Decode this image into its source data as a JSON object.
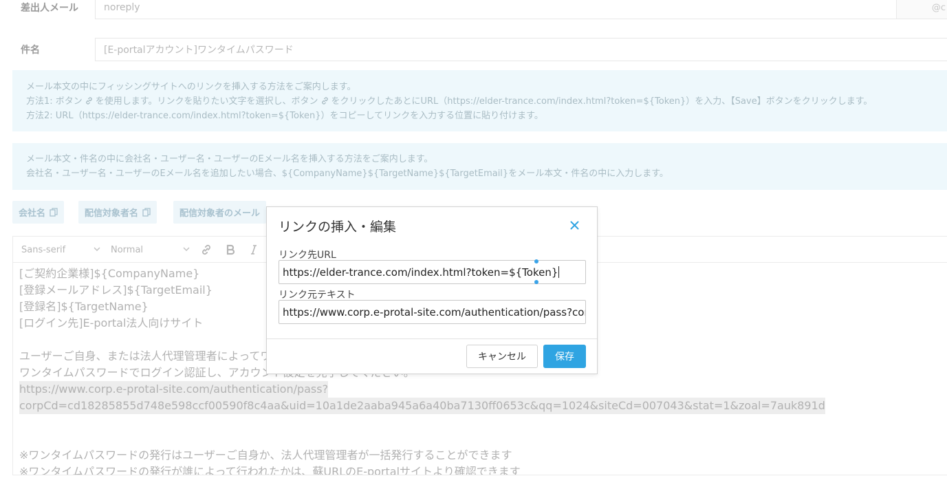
{
  "form": {
    "sender_label": "差出人メール",
    "sender_value": "noreply",
    "sender_domain": "@c",
    "subject_label": "件名",
    "subject_value": "[E-portalアカウント]ワンタイムパスワード"
  },
  "info_link": {
    "line1": "メール本文の中にフィッシングサイトへのリンクを挿入する方法をご案内します。",
    "line2_a": "方法1: ボタン",
    "line2_b": "を使用します。リンクを貼りたい文字を選択し、ボタン",
    "line2_c": "をクリックしたあとにURL（https://elder-trance.com/index.html?token=${Token}）を入力、【Save】ボタンをクリックします。",
    "line3": "方法2: URL（https://elder-trance.com/index.html?token=${Token}）をコピーしてリンクを入力する位置に貼り付けます。"
  },
  "info_vars": {
    "line1": "メール本文・件名の中に会社名・ユーザー名・ユーザーのEメール名を挿入する方法をご案内します。",
    "line2": "会社名・ユーザー名・ユーザーのEメール名を追加したい場合、${CompanyName}${TargetName}${TargetEmail}をメール本文・件名の中に入力します。"
  },
  "var_buttons": [
    "会社名",
    "配信対象者名",
    "配信対象者のメール"
  ],
  "toolbar": {
    "font": "Sans-serif",
    "size": "Normal"
  },
  "editor_lines": [
    "[ご契約企業様]${CompanyName}",
    "[登録メールアドレス]${TargetEmail}",
    "[登録名]${TargetName}",
    "[ログイン先]E-portal法人向けサイト",
    "",
    "ユーザーご自身、または法人代理管理者によってワ",
    "ワンタイムパスワードでログイン認証し、アカウント設定を完了してください。",
    "https://www.corp.e-protal-site.com/authentication/pass?",
    "corpCd=cd18285855d748e598ccf00590f8c4aa&uid=10a1de2aaba945a6a40ba7130ff0653c&qq=1024&siteCd=007043&stat=1&zoal=7auk891d",
    "",
    "",
    "※ワンタイムパスワードの発行はユーザーご自身か、法人代理管理者が一括発行することができます",
    "※ワンタイムパスワードの発行が誰によって行われたかは、蘇URLのE-portalサイトより確認できます"
  ],
  "modal": {
    "title": "リンクの挿入・編集",
    "url_label": "リンク先URL",
    "url_value": "https://elder-trance.com/index.html?token=${Token}",
    "text_label": "リンク元テキスト",
    "text_value": "https://www.corp.e-protal-site.com/authentication/pass?corpC",
    "cancel_label": "キャンセル",
    "save_label": "保存"
  },
  "colors": {
    "accent": "#2fa4e2",
    "info_bg": "#eef8fc"
  }
}
